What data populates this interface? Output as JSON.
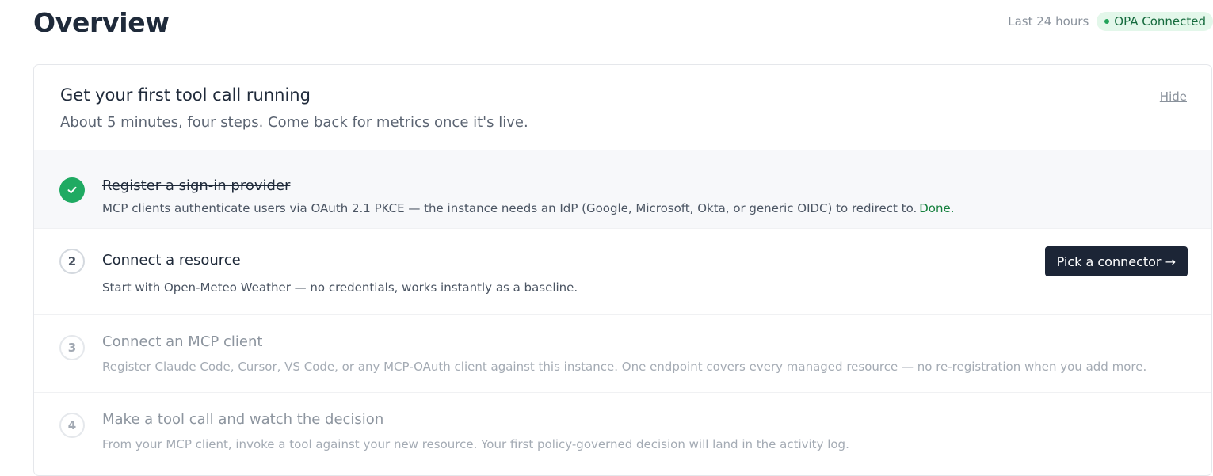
{
  "header": {
    "title": "Overview",
    "time_range": "Last 24 hours",
    "status_badge": "OPA Connected"
  },
  "onboarding": {
    "title": "Get your first tool call running",
    "subtitle": "About 5 minutes, four steps. Come back for metrics once it's live.",
    "hide_label": "Hide",
    "steps": [
      {
        "title": "Register a sign-in provider",
        "description": "MCP clients authenticate users via OAuth 2.1 PKCE — the instance needs an IdP (Google, Microsoft, Okta, or generic OIDC) to redirect to.",
        "done_label": "Done."
      },
      {
        "number": "2",
        "title": "Connect a resource",
        "description": "Start with Open-Meteo Weather — no credentials, works instantly as a baseline.",
        "action_label": "Pick a connector →"
      },
      {
        "number": "3",
        "title": "Connect an MCP client",
        "description": "Register Claude Code, Cursor, VS Code, or any MCP-OAuth client against this instance. One endpoint covers every managed resource — no re-registration when you add more."
      },
      {
        "number": "4",
        "title": "Make a tool call and watch the decision",
        "description": "From your MCP client, invoke a tool against your new resource. Your first policy-governed decision will land in the activity log."
      }
    ]
  },
  "icons": {
    "step_done": "check-icon",
    "status": "status-dot-icon"
  },
  "colors": {
    "success": "#1faa62",
    "badge_bg": "#e3f7ea",
    "primary_button": "#1c2536"
  }
}
